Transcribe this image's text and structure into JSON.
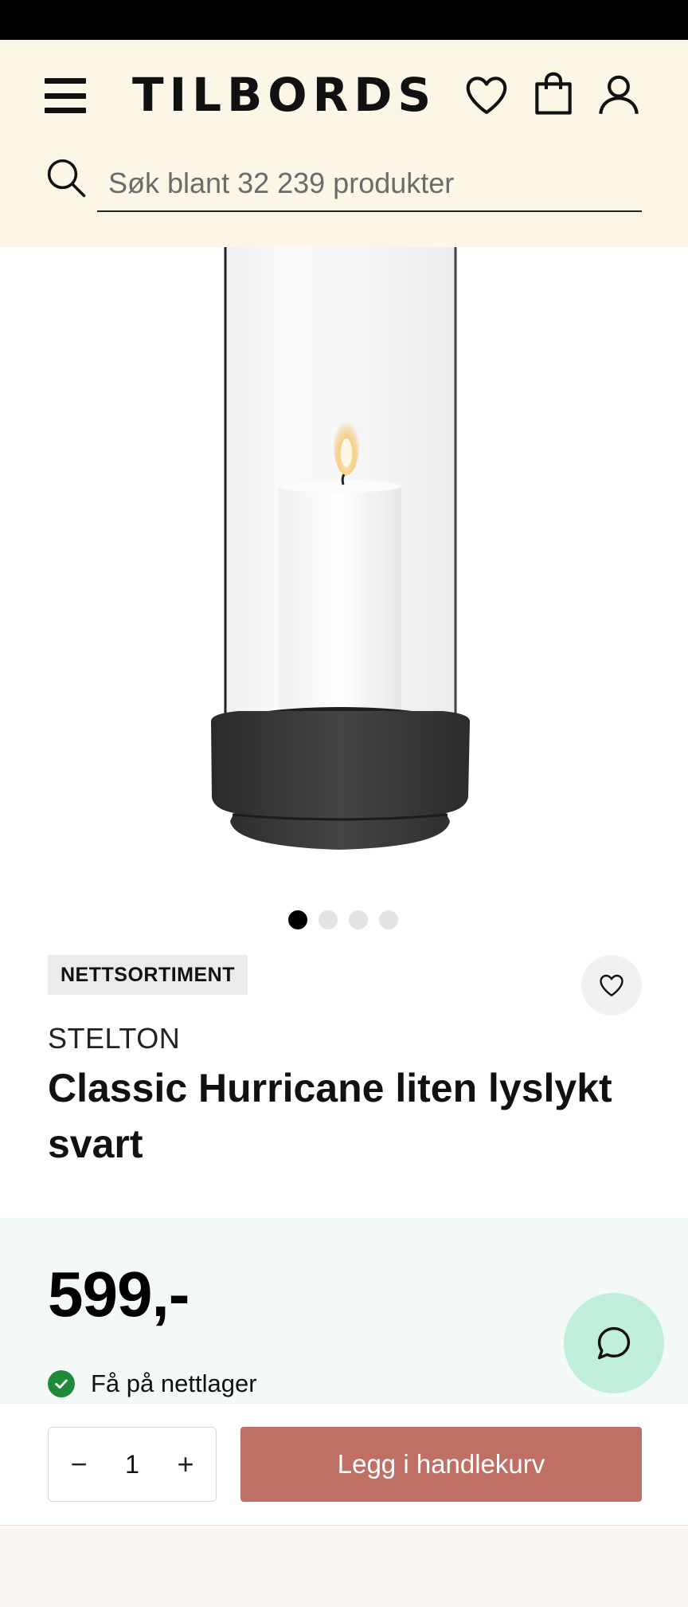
{
  "header": {
    "logo": "TILBORDS",
    "search_placeholder": "Søk blant 32 239 produkter"
  },
  "gallery": {
    "dot_count": 4,
    "active_index": 0
  },
  "product": {
    "badge": "NETTSORTIMENT",
    "brand": "STELTON",
    "title": "Classic Hurricane liten lyslykt svart",
    "price": "599,-",
    "stock": "Få på nettlager"
  },
  "purchase": {
    "quantity": "1",
    "minus": "−",
    "plus": "+",
    "add_to_cart": "Legg i handlekurv"
  },
  "colors": {
    "header_bg": "#fbf6e6",
    "price_panel_bg": "#f3f9f7",
    "cta": "#c06f64",
    "chat_bg": "#bfeedb",
    "stock_ok": "#1f8a3a"
  },
  "icons": [
    "menu-icon",
    "heart-icon",
    "shopping-bag-icon",
    "user-icon",
    "search-icon",
    "checkmark-icon",
    "chat-icon"
  ]
}
